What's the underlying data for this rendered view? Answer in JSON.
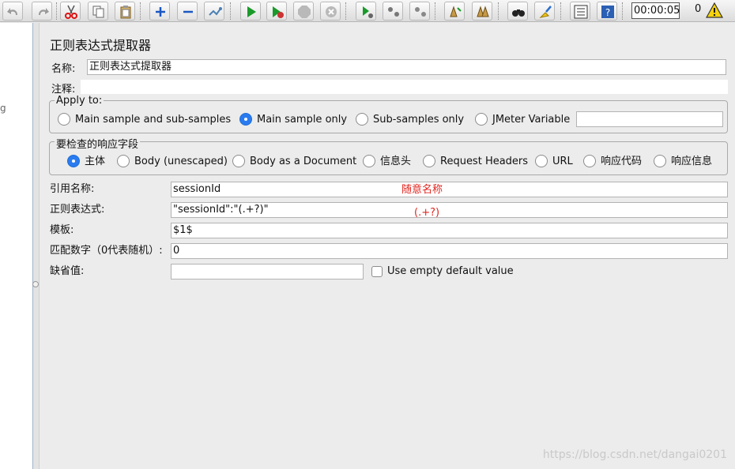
{
  "toolbar": {
    "timer": "00:00:05",
    "error_count": "0",
    "icons": [
      "undo-icon",
      "redo-icon",
      "cut-icon",
      "copy-icon",
      "paste-icon",
      "expand-icon",
      "collapse-icon",
      "toggle-icon",
      "start-icon",
      "start-no-pause-icon",
      "stop-icon",
      "shutdown-icon",
      "remote-start-icon",
      "remote-stop-icon",
      "remote-shutdown-icon",
      "clear-icon",
      "clear-all-icon",
      "search-icon",
      "reset-search-icon",
      "function-helper-icon",
      "help-icon",
      "warning-icon"
    ]
  },
  "tree": {
    "visible_text": "g"
  },
  "panel": {
    "title": "正则表达式提取器",
    "name_label": "名称:",
    "name_value": "正则表达式提取器",
    "comment_label": "注释:",
    "comment_value": ""
  },
  "apply_to": {
    "legend": "Apply to:",
    "options": [
      "Main sample and sub-samples",
      "Main sample only",
      "Sub-samples only",
      "JMeter Variable"
    ],
    "selected": "Main sample only",
    "variable_value": ""
  },
  "field_to_check": {
    "legend": "要检查的响应字段",
    "options": [
      "主体",
      "Body (unescaped)",
      "Body as a Document",
      "信息头",
      "Request Headers",
      "URL",
      "响应代码",
      "响应信息"
    ],
    "selected": "主体"
  },
  "form": {
    "ref_name_label": "引用名称:",
    "ref_name_value": "sessionId",
    "regex_label": "正则表达式:",
    "regex_value": "\"sessionId\":\"(.+?)\"",
    "template_label": "模板:",
    "template_value": "$1$",
    "match_no_label": "匹配数字（0代表随机）:",
    "match_no_value": "0",
    "default_label": "缺省值:",
    "default_value": "",
    "use_empty_label": "Use empty default value",
    "use_empty_checked": false
  },
  "annotations": {
    "ref_note": "随意名称",
    "regex_note": "(.+?)"
  },
  "watermark": "https://blog.csdn.net/dangai0201",
  "colors": {
    "accent": "#2a7bef",
    "annotation": "#e0251f"
  }
}
